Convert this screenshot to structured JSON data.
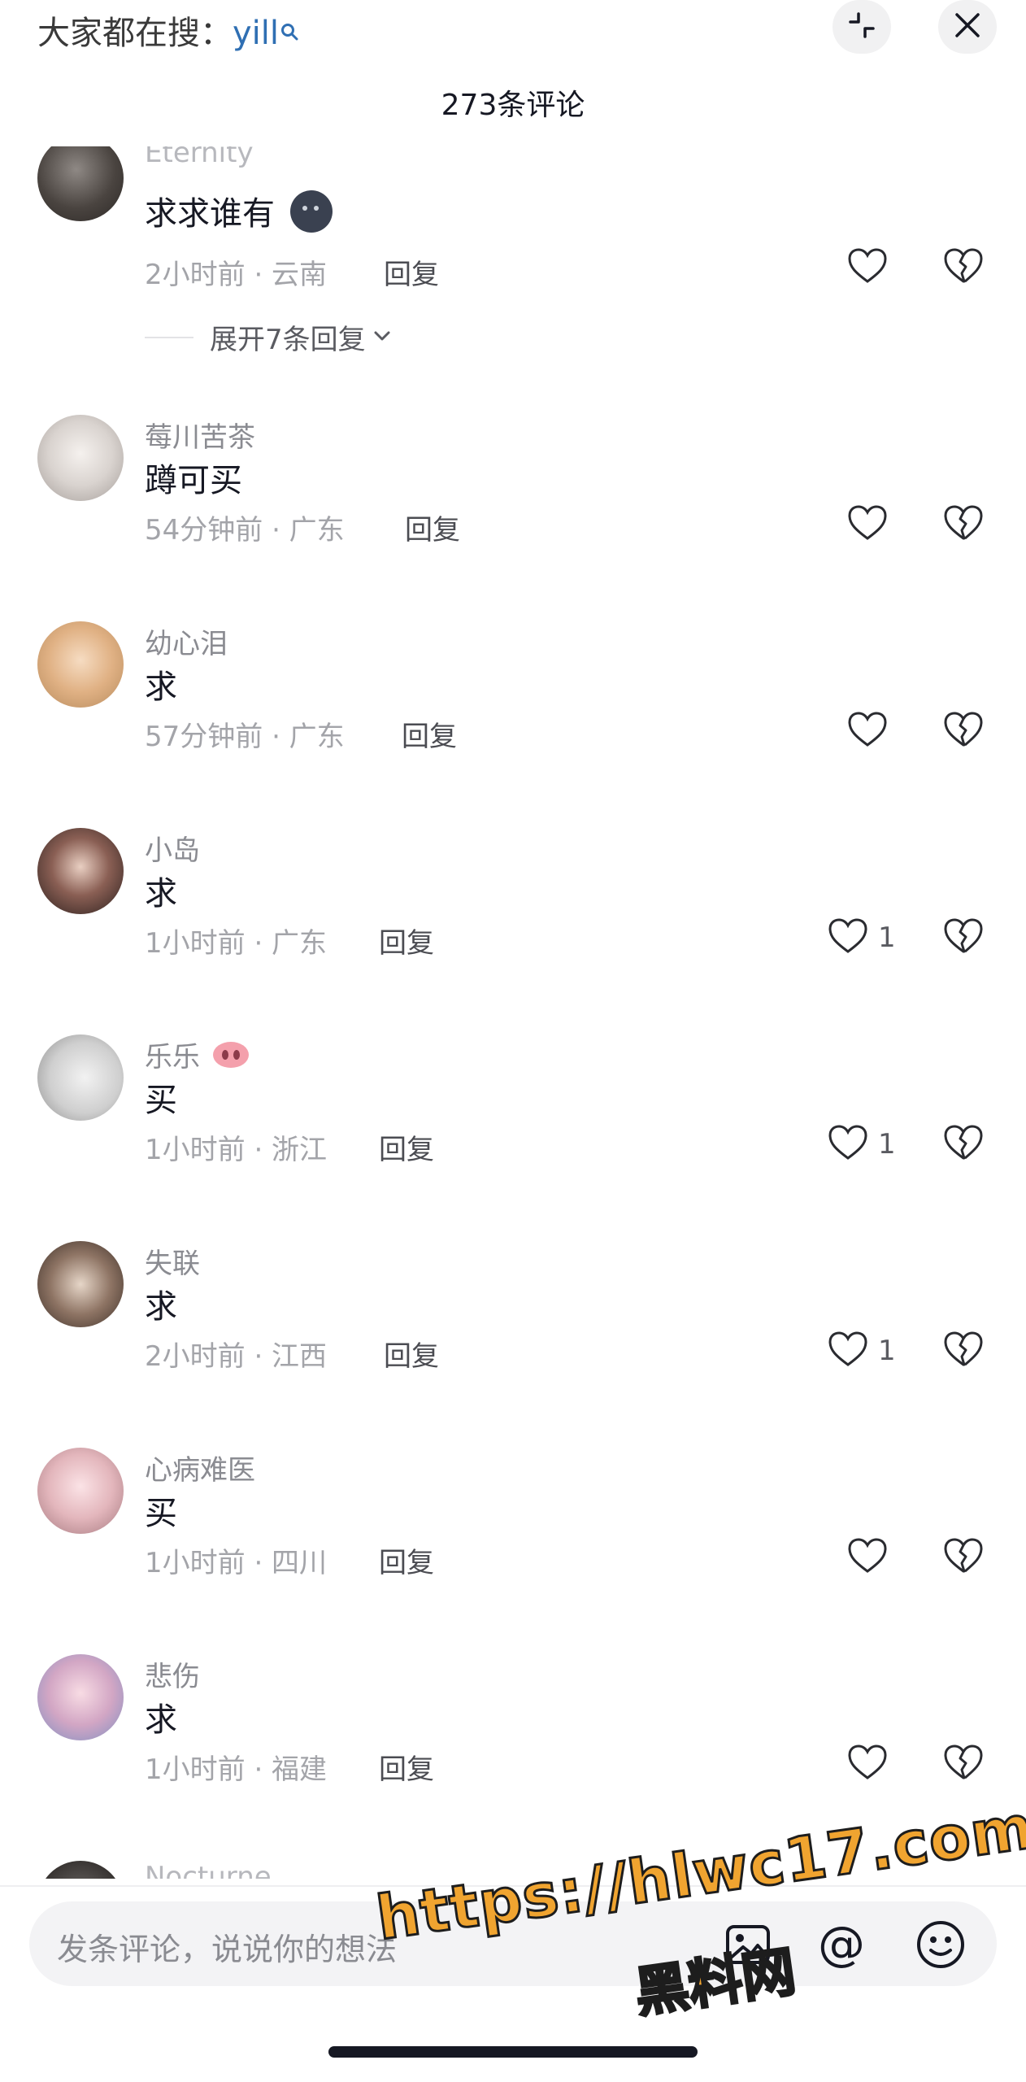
{
  "header": {
    "hot_search_prefix": "大家都在搜：",
    "hot_search_term": "yill",
    "comment_count_title": "273条评论"
  },
  "comments": [
    {
      "username": "Eternity",
      "text": "求求谁有",
      "emoji": "dark-blob-emoji",
      "meta": "2小时前 · 云南",
      "reply": "回复",
      "likes": "",
      "expand": "展开7条回复"
    },
    {
      "username": "莓川苦茶",
      "text": "蹲可买",
      "meta": "54分钟前 · 广东",
      "reply": "回复",
      "likes": ""
    },
    {
      "username": "幼心泪",
      "text": "求",
      "meta": "57分钟前 · 广东",
      "reply": "回复",
      "likes": ""
    },
    {
      "username": "小岛",
      "text": "求",
      "meta": "1小时前 · 广东",
      "reply": "回复",
      "likes": "1"
    },
    {
      "username": "乐乐",
      "username_emoji": "pig-nose-emoji",
      "text": "买",
      "meta": "1小时前 · 浙江",
      "reply": "回复",
      "likes": "1"
    },
    {
      "username": "失联",
      "text": "求",
      "meta": "2小时前 · 江西",
      "reply": "回复",
      "likes": "1"
    },
    {
      "username": "心病难医",
      "text": "买",
      "meta": "1小时前 · 四川",
      "reply": "回复",
      "likes": ""
    },
    {
      "username": "悲伤",
      "text": "求",
      "meta": "1小时前 · 福建",
      "reply": "回复",
      "likes": ""
    },
    {
      "username": "Nocturne"
    }
  ],
  "input": {
    "placeholder": "发条评论，说说你的想法",
    "at_symbol": "@"
  },
  "watermark": {
    "line1": "https://hlwc17.com",
    "line2": "黑料网"
  },
  "icons": [
    "search-icon",
    "collapse-icon",
    "close-icon",
    "heart-icon",
    "broken-heart-icon",
    "chevron-down-icon",
    "image-icon",
    "at-icon",
    "emoji-icon"
  ],
  "colors": {
    "accent_link": "#2f6fb3",
    "watermark": "#f0a430"
  }
}
